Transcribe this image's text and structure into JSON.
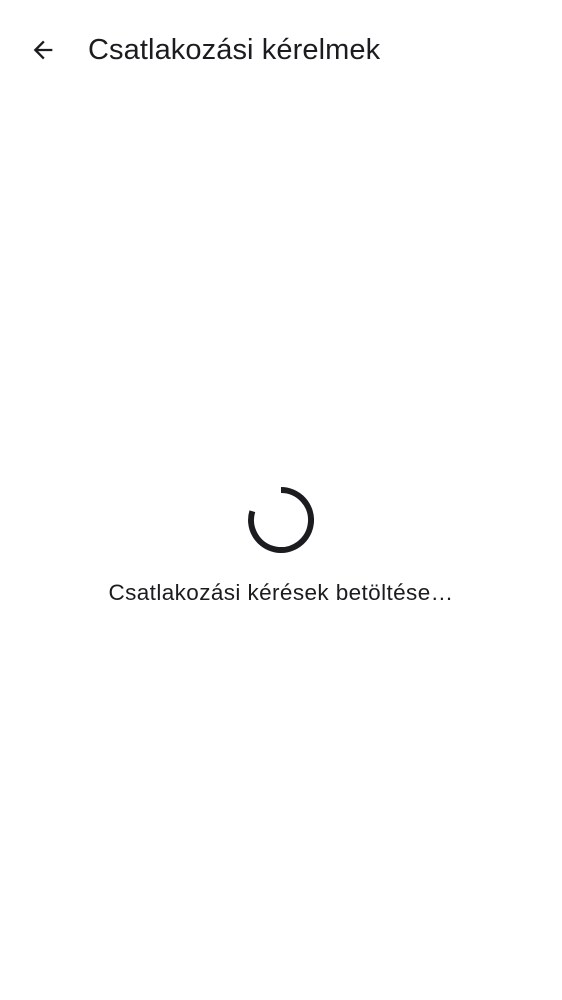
{
  "header": {
    "title": "Csatlakozási kérelmek",
    "back_icon": "arrow-back-icon"
  },
  "main": {
    "loading_text": "Csatlakozási kérések betöltése…",
    "spinner_icon": "progress-spinner-icon"
  },
  "colors": {
    "text": "#1c1b1f",
    "background": "#ffffff"
  }
}
